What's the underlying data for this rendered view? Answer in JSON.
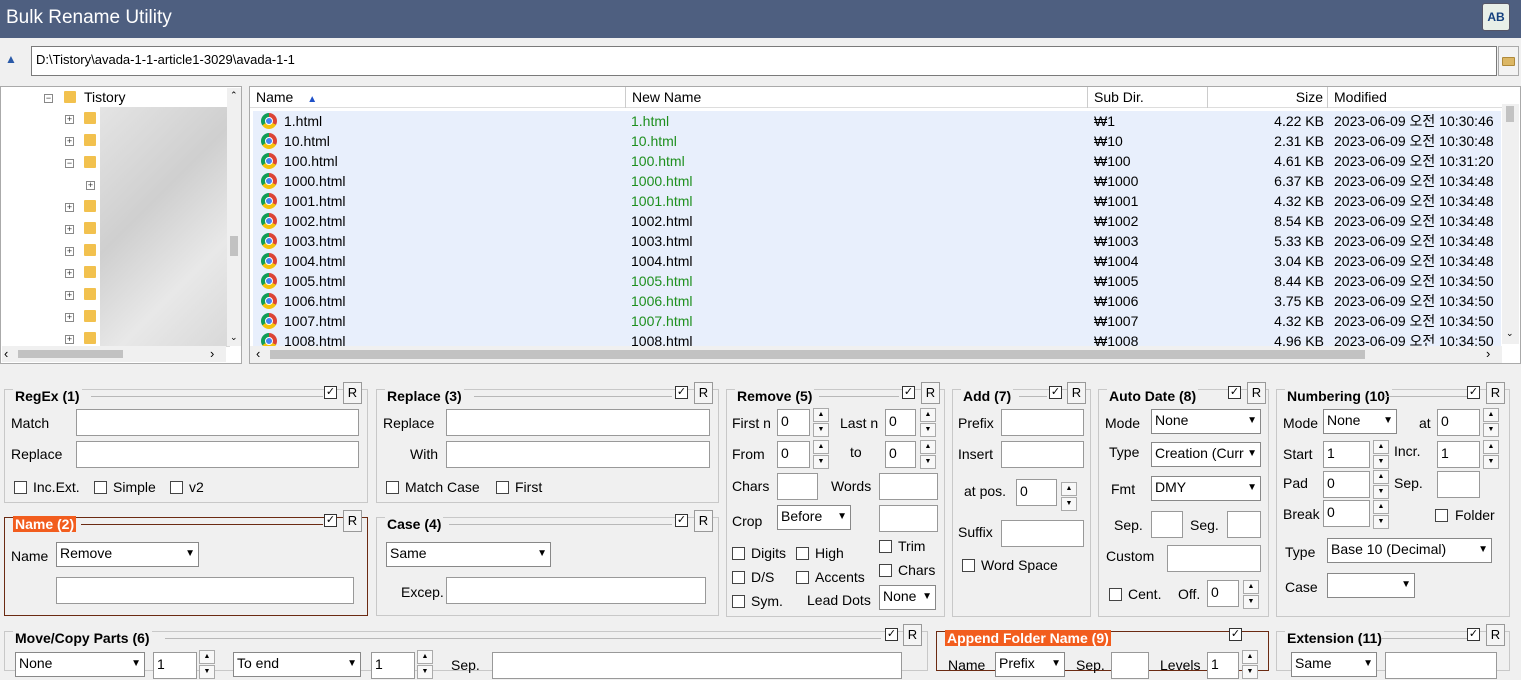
{
  "window": {
    "title": "Bulk Rename Utility",
    "app_icon": "AB"
  },
  "path": {
    "value": "D:\\Tistory\\avada-1-1-article1-3029\\avada-1-1"
  },
  "tree": {
    "root_label": "Tistory"
  },
  "list": {
    "columns": [
      "Name",
      "New Name",
      "Sub Dir.",
      "Size",
      "Modified"
    ],
    "sort_column": "Name",
    "rows": [
      {
        "name": "1.html",
        "new": "1.html",
        "changed": true,
        "sub": "₩1",
        "size": "4.22 KB",
        "mod": "2023-06-09 오전 10:30:46"
      },
      {
        "name": "10.html",
        "new": "10.html",
        "changed": true,
        "sub": "₩10",
        "size": "2.31 KB",
        "mod": "2023-06-09 오전 10:30:48"
      },
      {
        "name": "100.html",
        "new": "100.html",
        "changed": true,
        "sub": "₩100",
        "size": "4.61 KB",
        "mod": "2023-06-09 오전 10:31:20"
      },
      {
        "name": "1000.html",
        "new": "1000.html",
        "changed": true,
        "sub": "₩1000",
        "size": "6.37 KB",
        "mod": "2023-06-09 오전 10:34:48"
      },
      {
        "name": "1001.html",
        "new": "1001.html",
        "changed": true,
        "sub": "₩1001",
        "size": "4.32 KB",
        "mod": "2023-06-09 오전 10:34:48"
      },
      {
        "name": "1002.html",
        "new": "1002.html",
        "changed": false,
        "sub": "₩1002",
        "size": "8.54 KB",
        "mod": "2023-06-09 오전 10:34:48"
      },
      {
        "name": "1003.html",
        "new": "1003.html",
        "changed": false,
        "sub": "₩1003",
        "size": "5.33 KB",
        "mod": "2023-06-09 오전 10:34:48"
      },
      {
        "name": "1004.html",
        "new": "1004.html",
        "changed": false,
        "sub": "₩1004",
        "size": "3.04 KB",
        "mod": "2023-06-09 오전 10:34:48"
      },
      {
        "name": "1005.html",
        "new": "1005.html",
        "changed": true,
        "sub": "₩1005",
        "size": "8.44 KB",
        "mod": "2023-06-09 오전 10:34:50"
      },
      {
        "name": "1006.html",
        "new": "1006.html",
        "changed": true,
        "sub": "₩1006",
        "size": "3.75 KB",
        "mod": "2023-06-09 오전 10:34:50"
      },
      {
        "name": "1007.html",
        "new": "1007.html",
        "changed": true,
        "sub": "₩1007",
        "size": "4.32 KB",
        "mod": "2023-06-09 오전 10:34:50"
      },
      {
        "name": "1008.html",
        "new": "1008.html",
        "changed": false,
        "sub": "₩1008",
        "size": "4.96 KB",
        "mod": "2023-06-09 오전 10:34:50"
      }
    ]
  },
  "regex": {
    "title": "RegEx (1)",
    "match": "Match",
    "replace": "Replace",
    "incext": "Inc.Ext.",
    "simple": "Simple",
    "v2": "v2",
    "r": "R"
  },
  "replace": {
    "title": "Replace (3)",
    "replace": "Replace",
    "with": "With",
    "matchcase": "Match Case",
    "first": "First",
    "r": "R"
  },
  "remove": {
    "title": "Remove (5)",
    "firstn": "First n",
    "firstn_val": "0",
    "lastn": "Last n",
    "lastn_val": "0",
    "from": "From",
    "from_val": "0",
    "to": "to",
    "to_val": "0",
    "chars": "Chars",
    "words": "Words",
    "crop": "Crop",
    "crop_val": "Before",
    "digits": "Digits",
    "high": "High",
    "trim": "Trim",
    "ds": "D/S",
    "accents": "Accents",
    "chars2": "Chars",
    "sym": "Sym.",
    "leaddots": "Lead Dots",
    "leaddots_val": "None",
    "r": "R"
  },
  "add": {
    "title": "Add (7)",
    "prefix": "Prefix",
    "insert": "Insert",
    "atpos": "at pos.",
    "atpos_val": "0",
    "suffix": "Suffix",
    "wordspace": "Word Space",
    "r": "R"
  },
  "autodate": {
    "title": "Auto Date (8)",
    "mode": "Mode",
    "mode_val": "None",
    "type": "Type",
    "type_val": "Creation (Curr",
    "fmt": "Fmt",
    "fmt_val": "DMY",
    "sep": "Sep.",
    "seg": "Seg.",
    "custom": "Custom",
    "cent": "Cent.",
    "off": "Off.",
    "off_val": "0",
    "r": "R"
  },
  "numbering": {
    "title": "Numbering (10)",
    "mode": "Mode",
    "mode_val": "None",
    "at": "at",
    "at_val": "0",
    "start": "Start",
    "start_val": "1",
    "incr": "Incr.",
    "incr_val": "1",
    "pad": "Pad",
    "pad_val": "0",
    "sep": "Sep.",
    "break": "Break",
    "break_val": "0",
    "folder": "Folder",
    "type": "Type",
    "type_val": "Base 10 (Decimal)",
    "case": "Case",
    "r": "R"
  },
  "name": {
    "title": "Name (2)",
    "name": "Name",
    "name_val": "Remove",
    "r": "R"
  },
  "case": {
    "title": "Case (4)",
    "case_val": "Same",
    "excep": "Excep.",
    "r": "R"
  },
  "movecopy": {
    "title": "Move/Copy Parts (6)",
    "sel1": "None",
    "n1": "1",
    "sel2": "To end",
    "n2": "1",
    "sep": "Sep.",
    "r": "R"
  },
  "appendfolder": {
    "title": "Append Folder Name (9)",
    "name": "Name",
    "name_val": "Prefix",
    "sep": "Sep.",
    "levels": "Levels",
    "levels_val": "1"
  },
  "extension": {
    "title": "Extension (11)",
    "val": "Same",
    "r": "R"
  }
}
